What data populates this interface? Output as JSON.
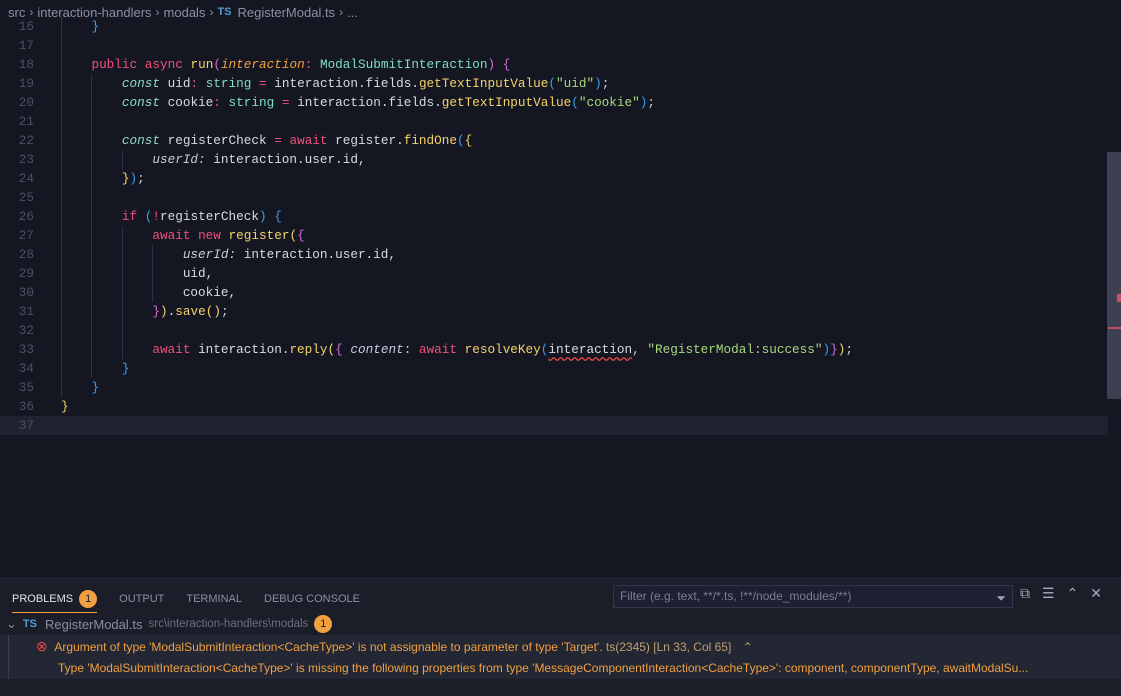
{
  "breadcrumb": {
    "items": [
      "src",
      "interaction-handlers",
      "modals"
    ],
    "file_badge": "TS",
    "file": "RegisterModal.ts",
    "more": "..."
  },
  "editor": {
    "lines": [
      {
        "n": "16",
        "i": 1,
        "t": [
          [
            "b3",
            "}"
          ]
        ]
      },
      {
        "n": "17",
        "i": 1,
        "t": []
      },
      {
        "n": "18",
        "i": 1,
        "t": [
          [
            "kw",
            "public"
          ],
          [
            "pl",
            " "
          ],
          [
            "kw",
            "async"
          ],
          [
            "pl",
            " "
          ],
          [
            "fn",
            "run"
          ],
          [
            "b2",
            "("
          ],
          [
            "pa",
            "interaction"
          ],
          [
            "op",
            ":"
          ],
          [
            "pl",
            " "
          ],
          [
            "ty",
            "ModalSubmitInteraction"
          ],
          [
            "b2",
            ")"
          ],
          [
            "pl",
            " "
          ],
          [
            "b2",
            "{"
          ]
        ]
      },
      {
        "n": "19",
        "i": 2,
        "t": [
          [
            "st",
            "const"
          ],
          [
            "pl",
            " "
          ],
          [
            "va",
            "uid"
          ],
          [
            "op",
            ":"
          ],
          [
            "pl",
            " "
          ],
          [
            "ty",
            "string"
          ],
          [
            "pl",
            " "
          ],
          [
            "op",
            "="
          ],
          [
            "pl",
            " "
          ],
          [
            "va",
            "interaction.fields."
          ],
          [
            "fn",
            "getTextInputValue"
          ],
          [
            "b3",
            "("
          ],
          [
            "str",
            "\"uid\""
          ],
          [
            "b3",
            ")"
          ],
          [
            "pl",
            ";"
          ]
        ]
      },
      {
        "n": "20",
        "i": 2,
        "t": [
          [
            "st",
            "const"
          ],
          [
            "pl",
            " "
          ],
          [
            "va",
            "cookie"
          ],
          [
            "op",
            ":"
          ],
          [
            "pl",
            " "
          ],
          [
            "ty",
            "string"
          ],
          [
            "pl",
            " "
          ],
          [
            "op",
            "="
          ],
          [
            "pl",
            " "
          ],
          [
            "va",
            "interaction.fields."
          ],
          [
            "fn",
            "getTextInputValue"
          ],
          [
            "b3",
            "("
          ],
          [
            "str",
            "\"cookie\""
          ],
          [
            "b3",
            ")"
          ],
          [
            "pl",
            ";"
          ]
        ]
      },
      {
        "n": "21",
        "i": 2,
        "t": []
      },
      {
        "n": "22",
        "i": 2,
        "t": [
          [
            "st",
            "const"
          ],
          [
            "pl",
            " "
          ],
          [
            "va",
            "registerCheck"
          ],
          [
            "pl",
            " "
          ],
          [
            "op",
            "="
          ],
          [
            "pl",
            " "
          ],
          [
            "kw",
            "await"
          ],
          [
            "pl",
            " "
          ],
          [
            "va",
            "register."
          ],
          [
            "fn",
            "findOne"
          ],
          [
            "b3",
            "("
          ],
          [
            "b1",
            "{"
          ]
        ]
      },
      {
        "n": "23",
        "i": 3,
        "t": [
          [
            "pr",
            "userId:"
          ],
          [
            "pl",
            " "
          ],
          [
            "va",
            "interaction.user.id,"
          ]
        ]
      },
      {
        "n": "24",
        "i": 2,
        "t": [
          [
            "b1",
            "}"
          ],
          [
            "b3",
            ")"
          ],
          [
            "pl",
            ";"
          ]
        ]
      },
      {
        "n": "25",
        "i": 2,
        "t": []
      },
      {
        "n": "26",
        "i": 2,
        "t": [
          [
            "kw",
            "if"
          ],
          [
            "pl",
            " "
          ],
          [
            "b3",
            "("
          ],
          [
            "kw",
            "!"
          ],
          [
            "va",
            "registerCheck"
          ],
          [
            "b3",
            ")"
          ],
          [
            "pl",
            " "
          ],
          [
            "b3",
            "{"
          ]
        ]
      },
      {
        "n": "27",
        "i": 3,
        "t": [
          [
            "kw",
            "await"
          ],
          [
            "pl",
            " "
          ],
          [
            "kw",
            "new"
          ],
          [
            "pl",
            " "
          ],
          [
            "fn",
            "register"
          ],
          [
            "b1",
            "("
          ],
          [
            "b2",
            "{"
          ]
        ]
      },
      {
        "n": "28",
        "i": 4,
        "t": [
          [
            "pr",
            "userId:"
          ],
          [
            "pl",
            " "
          ],
          [
            "va",
            "interaction.user.id,"
          ]
        ]
      },
      {
        "n": "29",
        "i": 4,
        "t": [
          [
            "va",
            "uid,"
          ]
        ]
      },
      {
        "n": "30",
        "i": 4,
        "t": [
          [
            "va",
            "cookie,"
          ]
        ]
      },
      {
        "n": "31",
        "i": 3,
        "t": [
          [
            "b2",
            "}"
          ],
          [
            "b1",
            ")"
          ],
          [
            "va",
            "."
          ],
          [
            "fn",
            "save"
          ],
          [
            "b1",
            "()"
          ],
          [
            "pl",
            ";"
          ]
        ]
      },
      {
        "n": "32",
        "i": 3,
        "t": []
      },
      {
        "n": "33",
        "i": 3,
        "t": [
          [
            "kw",
            "await"
          ],
          [
            "pl",
            " "
          ],
          [
            "va",
            "interaction."
          ],
          [
            "fn",
            "reply"
          ],
          [
            "b1",
            "("
          ],
          [
            "b2",
            "{"
          ],
          [
            "pl",
            " "
          ],
          [
            "pr",
            "content"
          ],
          [
            "pl",
            ": "
          ],
          [
            "kw",
            "await"
          ],
          [
            "pl",
            " "
          ],
          [
            "fn",
            "resolveKey"
          ],
          [
            "b3",
            "("
          ],
          [
            "va err",
            "interaction"
          ],
          [
            "pl",
            ", "
          ],
          [
            "str",
            "\"RegisterModal:success\""
          ],
          [
            "b3",
            ")"
          ],
          [
            "b2",
            "}"
          ],
          [
            "b1",
            ")"
          ],
          [
            "pl",
            ";"
          ]
        ]
      },
      {
        "n": "34",
        "i": 2,
        "t": [
          [
            "b3",
            "}"
          ]
        ]
      },
      {
        "n": "35",
        "i": 1,
        "t": [
          [
            "b3",
            "}"
          ]
        ]
      },
      {
        "n": "36",
        "i": 0,
        "t": [
          [
            "b1",
            "}"
          ]
        ]
      },
      {
        "n": "37",
        "i": 0,
        "t": [],
        "cur": true
      }
    ]
  },
  "panel": {
    "tabs": [
      {
        "label": "PROBLEMS",
        "badge": "1",
        "active": true
      },
      {
        "label": "OUTPUT"
      },
      {
        "label": "TERMINAL"
      },
      {
        "label": "DEBUG CONSOLE"
      }
    ],
    "filter_placeholder": "Filter (e.g. text, **/*.ts, !**/node_modules/**)",
    "file": {
      "badge": "TS",
      "name": "RegisterModal.ts",
      "path": "src\\interaction-handlers\\modals",
      "count": "1"
    },
    "problem": {
      "message": "Argument of type 'ModalSubmitInteraction<CacheType>' is not assignable to parameter of type 'Target'.",
      "code": "ts(2345)",
      "location": "[Ln 33, Col 65]",
      "detail": "Type 'ModalSubmitInteraction<CacheType>' is missing the following properties from type 'MessageComponentInteraction<CacheType>': component, componentType, awaitModalSu..."
    }
  },
  "colors": {
    "background": "#141722",
    "panel": "#1b1d28",
    "accent": "#f0a040",
    "error": "#f04848"
  }
}
